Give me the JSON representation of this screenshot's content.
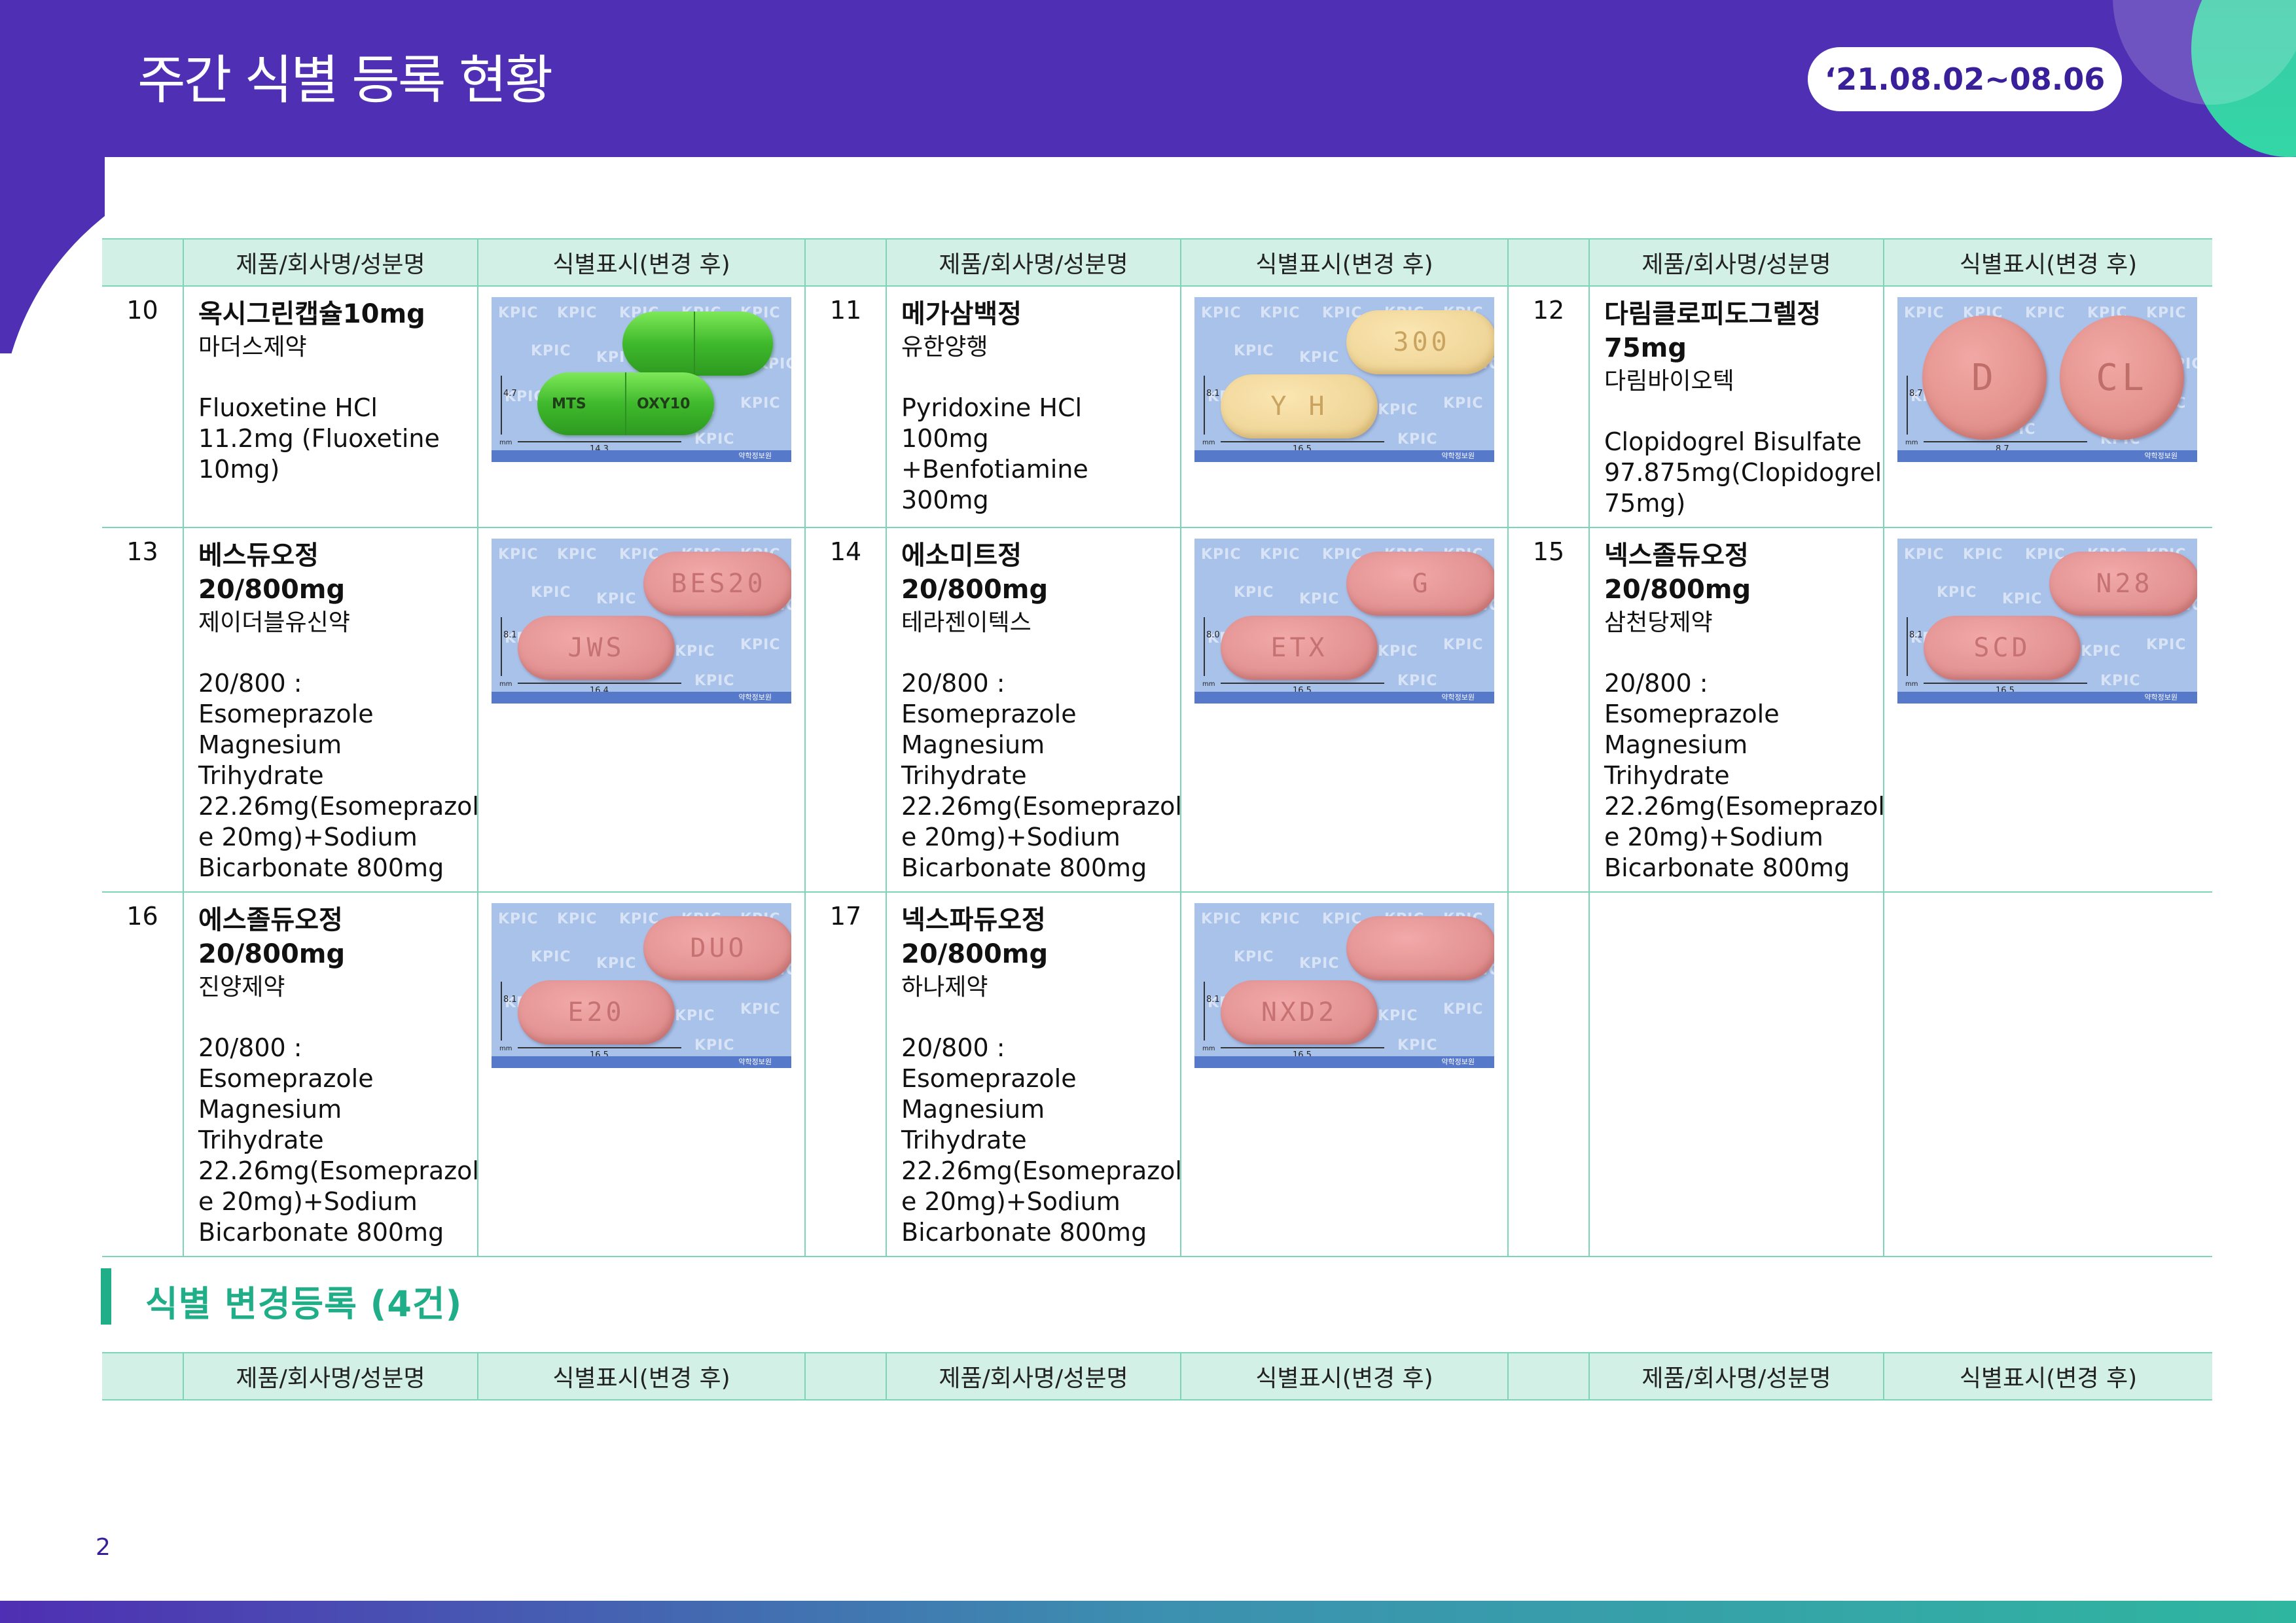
{
  "header": {
    "title": "주간 식별 등록 현황",
    "date_range": "‘21.08.02~08.06"
  },
  "table": {
    "col_product": "제품/회사명/성분명",
    "col_marking": "식별표시(변경 후)",
    "rows": [
      [
        {
          "no": "10",
          "name": "옥시그린캡슐10mg",
          "company": "마더스제약",
          "ingredient": "Fluoxetine HCl 11.2mg (Fluoxetine 10mg)",
          "image": {
            "kind": "capsule",
            "color": "#4cc83a",
            "marks": [
              "MTS",
              "OXY10"
            ],
            "height": "4.7",
            "width": "14.3"
          }
        },
        {
          "no": "11",
          "name": "메가삼백정",
          "company": "유한양행",
          "ingredient": "Pyridoxine HCl 100mg +Benfotiamine 300mg",
          "image": {
            "kind": "oblong",
            "color": "#f3dca0",
            "marks": [
              "Y H",
              "300"
            ],
            "height": "8.1",
            "width": "16.5"
          }
        },
        {
          "no": "12",
          "name": "다림클로피도그렐정 75mg",
          "company": "다림바이오텍",
          "ingredient": "Clopidogrel Bisulfate 97.875mg(Clopidogrel 75mg)",
          "image": {
            "kind": "round",
            "color": "#e8958f",
            "marks": [
              "D",
              "CL"
            ],
            "height": "8.7",
            "width": "8.7"
          }
        }
      ],
      [
        {
          "no": "13",
          "name": "베스듀오정20/800mg",
          "company": "제이더블유신약",
          "ingredient": "20/800 : Esomeprazole Magnesium Trihydrate 22.26mg(Esomeprazol e 20mg)+Sodium Bicarbonate 800mg",
          "image": {
            "kind": "oblong",
            "color": "#e79a98",
            "marks": [
              "JWS",
              "BES20"
            ],
            "height": "8.1",
            "width": "16.4"
          }
        },
        {
          "no": "14",
          "name": "에소미트정20/800mg",
          "company": "테라젠이텍스",
          "ingredient": "20/800 : Esomeprazole Magnesium Trihydrate 22.26mg(Esomeprazol e 20mg)+Sodium Bicarbonate 800mg",
          "image": {
            "kind": "oblong",
            "color": "#e79a98",
            "marks": [
              "ETX",
              "G"
            ],
            "height": "8.0",
            "width": "16.5"
          }
        },
        {
          "no": "15",
          "name": "넥스졸듀오정 20/800mg",
          "company": "삼천당제약",
          "ingredient": "20/800 : Esomeprazole Magnesium Trihydrate 22.26mg(Esomeprazol e 20mg)+Sodium Bicarbonate 800mg",
          "image": {
            "kind": "oblong",
            "color": "#e79a98",
            "marks": [
              "SCD",
              "N28"
            ],
            "height": "8.1",
            "width": "16.5"
          }
        }
      ],
      [
        {
          "no": "16",
          "name": "에스졸듀오정 20/800mg",
          "company": "진양제약",
          "ingredient": "20/800 : Esomeprazole Magnesium Trihydrate 22.26mg(Esomeprazol e 20mg)+Sodium Bicarbonate 800mg",
          "image": {
            "kind": "oblong",
            "color": "#e79a98",
            "marks": [
              "E20",
              "DUO"
            ],
            "height": "8.1",
            "width": "16.5"
          }
        },
        {
          "no": "17",
          "name": "넥스파듀오정 20/800mg",
          "company": "하나제약",
          "ingredient": "20/800 : Esomeprazole Magnesium Trihydrate 22.26mg(Esomeprazol e 20mg)+Sodium Bicarbonate 800mg",
          "image": {
            "kind": "oblong",
            "color": "#e79a98",
            "marks": [
              "NXD2",
              ""
            ],
            "height": "8.1",
            "width": "16.5"
          }
        },
        null
      ]
    ]
  },
  "image_labels": {
    "watermark": "KPIC",
    "unit": "mm",
    "footer_mark": "약학정보원"
  },
  "section": {
    "title": "식별 변경등록 (4건)"
  },
  "table2": {
    "col_product": "제품/회사명/성분명",
    "col_marking": "식별표시(변경 후)"
  },
  "page_number": "2",
  "colors": {
    "header_purple": "#4f2fb3",
    "accent_teal": "#1fae88",
    "table_header_bg": "#d2f0e6",
    "table_border": "#7dd5b8"
  }
}
